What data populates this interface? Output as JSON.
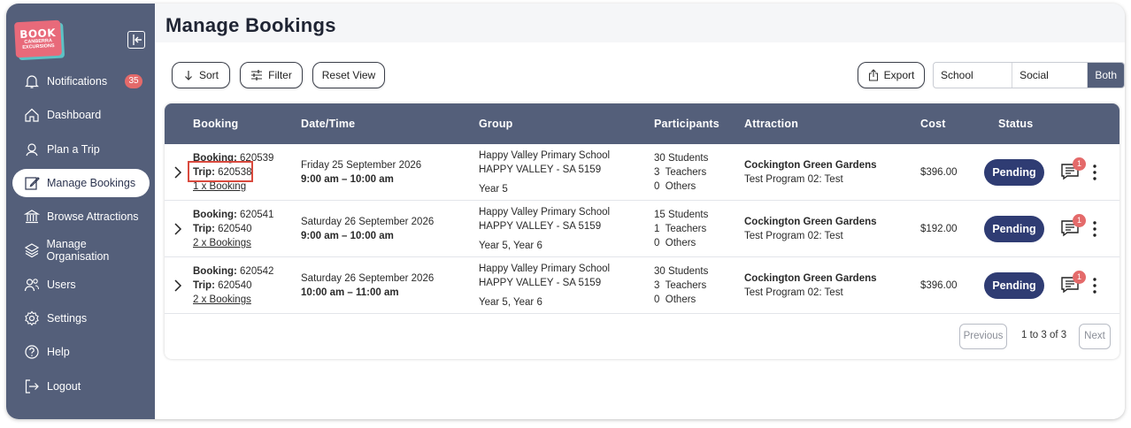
{
  "logo": {
    "line1": "BOOK",
    "line2": "CANBERRA",
    "line3": "EXCURSIONS"
  },
  "sidebar": {
    "items": [
      {
        "label": "Notifications",
        "badge": "35",
        "icon": "bell-icon"
      },
      {
        "label": "Dashboard",
        "icon": "home-icon"
      },
      {
        "label": "Plan a Trip",
        "icon": "map-pin-icon"
      },
      {
        "label": "Manage Bookings",
        "icon": "edit-icon",
        "active": true
      },
      {
        "label": "Browse Attractions",
        "icon": "building-icon"
      },
      {
        "label": "Manage Organisation",
        "icon": "layers-icon"
      },
      {
        "label": "Users",
        "icon": "users-icon"
      },
      {
        "label": "Settings",
        "icon": "gear-icon"
      },
      {
        "label": "Help",
        "icon": "help-icon"
      },
      {
        "label": "Logout",
        "icon": "logout-icon"
      }
    ]
  },
  "page": {
    "title": "Manage Bookings"
  },
  "toolbar": {
    "sort_label": "Sort",
    "filter_label": "Filter",
    "reset_label": "Reset View",
    "export_label": "Export",
    "segments": [
      "School Group",
      "Social Group",
      "Both"
    ],
    "selected_segment": "Both"
  },
  "table": {
    "headers": [
      "Booking",
      "Date/Time",
      "Group",
      "Participants",
      "Attraction",
      "Cost",
      "Status"
    ],
    "rows": [
      {
        "booking_label": "Booking:",
        "booking": "620539",
        "trip_label": "Trip:",
        "trip": "620538",
        "bookings_link": "1 x Booking",
        "date": "Friday 25 September 2026",
        "time": "9:00 am – 10:00 am",
        "group_name": "Happy Valley Primary School",
        "group_location": "HAPPY VALLEY - SA 5159",
        "group_years": "Year 5",
        "p1": "30 Students",
        "p2": "3  Teachers",
        "p3": "0  Others",
        "attraction": "Cockington Green Gardens",
        "program": "Test Program 02: Test",
        "cost": "$396.00",
        "status": "Pending",
        "messages": "1"
      },
      {
        "booking_label": "Booking:",
        "booking": "620541",
        "trip_label": "Trip:",
        "trip": "620540",
        "bookings_link": "2 x Bookings",
        "date": "Saturday 26 September 2026",
        "time": "9:00 am – 10:00 am",
        "group_name": "Happy Valley Primary School",
        "group_location": "HAPPY VALLEY - SA 5159",
        "group_years": "Year 5, Year 6",
        "p1": "15 Students",
        "p2": "1  Teachers",
        "p3": "0  Others",
        "attraction": "Cockington Green Gardens",
        "program": "Test Program 02: Test",
        "cost": "$192.00",
        "status": "Pending",
        "messages": "1"
      },
      {
        "booking_label": "Booking:",
        "booking": "620542",
        "trip_label": "Trip:",
        "trip": "620540",
        "bookings_link": "2 x Bookings",
        "date": "Saturday 26 September 2026",
        "time": "10:00 am – 11:00 am",
        "group_name": "Happy Valley Primary School",
        "group_location": "HAPPY VALLEY - SA 5159",
        "group_years": "Year 5, Year 6",
        "p1": "30 Students",
        "p2": "3  Teachers",
        "p3": "0  Others",
        "attraction": "Cockington Green Gardens",
        "program": "Test Program 02: Test",
        "cost": "$396.00",
        "status": "Pending",
        "messages": "1"
      }
    ]
  },
  "pagination": {
    "previous": "Previous",
    "range": "1 to 3 of 3",
    "next": "Next"
  },
  "colors": {
    "sidebar": "#545f7a",
    "status_pill": "#2f3c73",
    "badge": "#e46a6a",
    "highlight": "#d94a3e"
  }
}
